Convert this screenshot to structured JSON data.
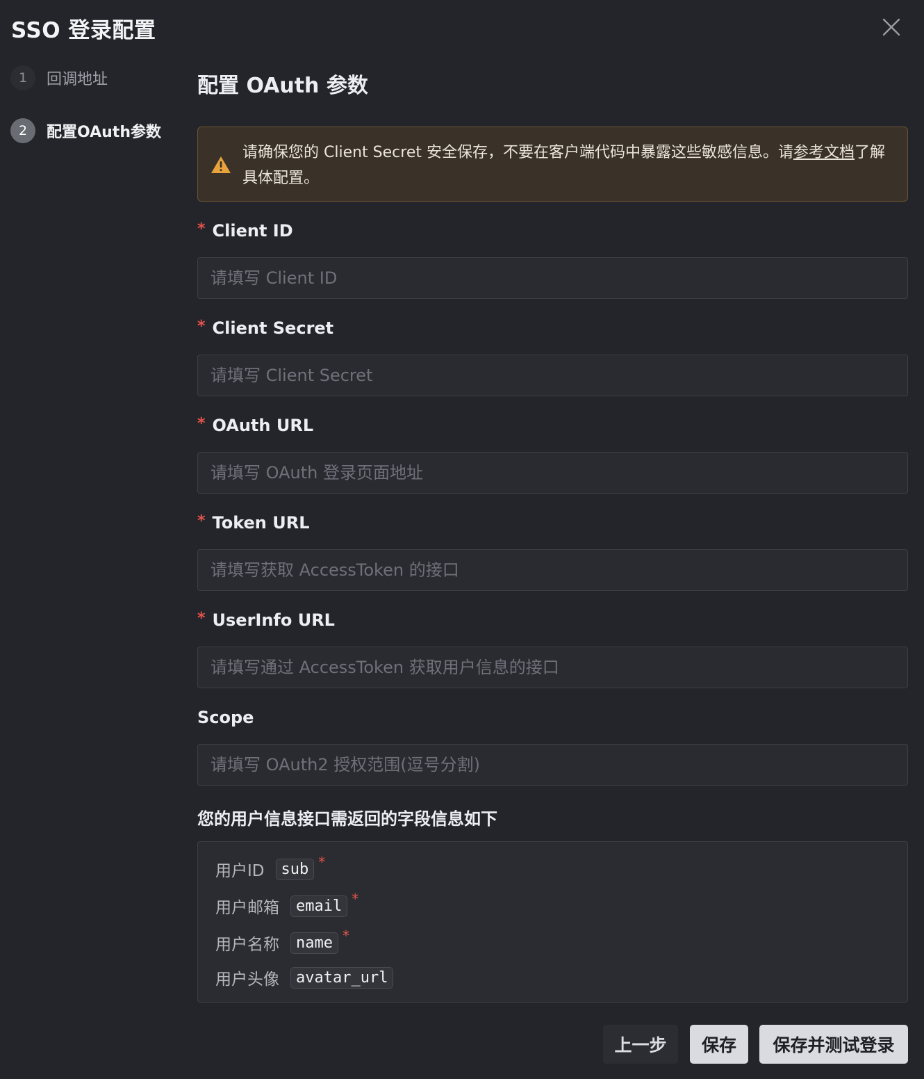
{
  "dialog": {
    "title": "SSO 登录配置",
    "close_icon": "close-icon"
  },
  "steps": [
    {
      "number": "1",
      "label": "回调地址",
      "state": "inactive"
    },
    {
      "number": "2",
      "label": "配置OAuth参数",
      "state": "active"
    }
  ],
  "main": {
    "section_title": "配置 OAuth 参数",
    "alert": {
      "icon": "warning-icon",
      "text_before": "请确保您的 Client Secret 安全保存，不要在客户端代码中暴露这些敏感信息。请",
      "link_text": "参考文档",
      "text_after": "了解具体配置。"
    },
    "fields": [
      {
        "label": "Client ID",
        "required": "*",
        "value": "",
        "placeholder": "请填写 Client ID"
      },
      {
        "label": "Client Secret",
        "required": "*",
        "value": "",
        "placeholder": "请填写 Client Secret"
      },
      {
        "label": "OAuth URL",
        "required": "*",
        "value": "",
        "placeholder": "请填写 OAuth 登录页面地址"
      },
      {
        "label": "Token URL",
        "required": "*",
        "value": "",
        "placeholder": "请填写获取 AccessToken 的接口"
      },
      {
        "label": "UserInfo URL",
        "required": "*",
        "value": "",
        "placeholder": "请填写通过 AccessToken 获取用户信息的接口"
      },
      {
        "label": "Scope",
        "required": "",
        "value": "",
        "placeholder": "请填写 OAuth2 授权范围(逗号分割)"
      }
    ],
    "userinfo_title": "您的用户信息接口需返回的字段信息如下",
    "userinfo_fields": [
      {
        "label": "用户ID",
        "key": "sub",
        "required": "*"
      },
      {
        "label": "用户邮箱",
        "key": "email",
        "required": "*"
      },
      {
        "label": "用户名称",
        "key": "name",
        "required": "*"
      },
      {
        "label": "用户头像",
        "key": "avatar_url",
        "required": ""
      }
    ]
  },
  "footer": {
    "prev_label": "上一步",
    "save_label": "保存",
    "save_test_label": "保存并测试登录"
  }
}
